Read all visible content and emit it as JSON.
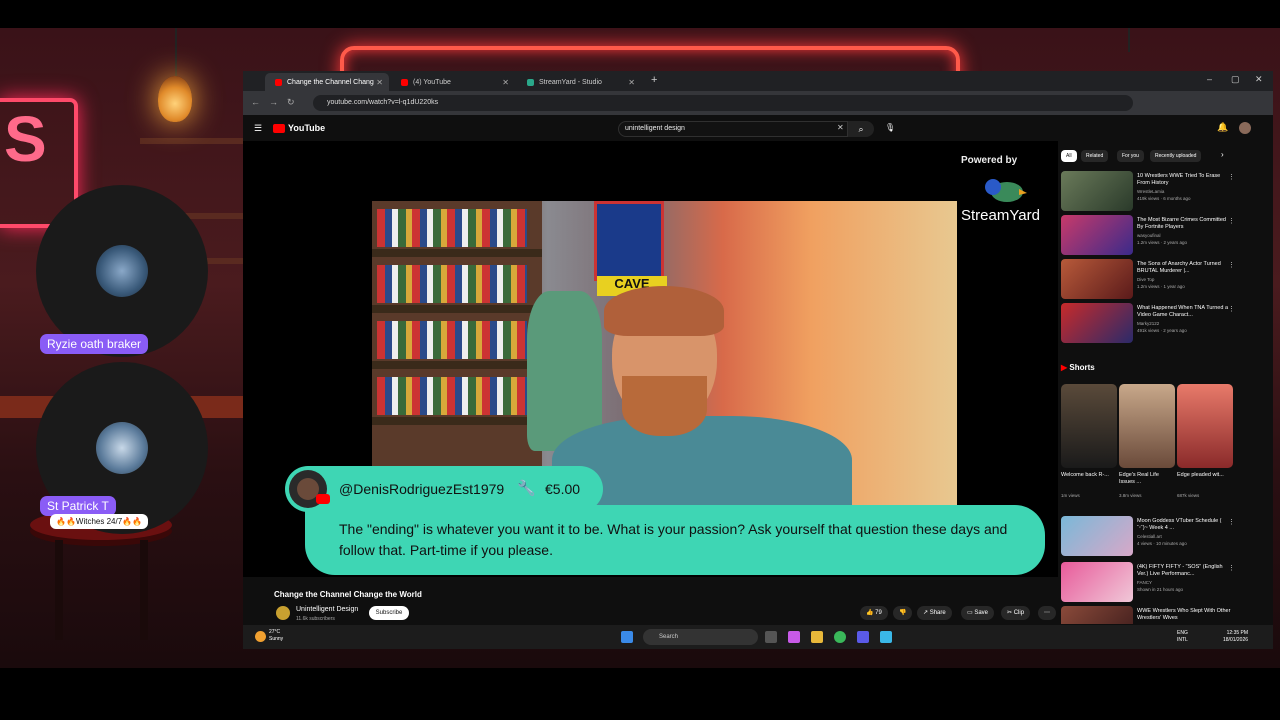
{
  "guests": [
    {
      "name": "Ryzie oath braker",
      "sub": ""
    },
    {
      "name": "St Patrick T",
      "sub": "🔥🔥Witches 24/7🔥🔥"
    }
  ],
  "browser": {
    "tabs": [
      {
        "label": "Change the Channel Chang",
        "active": true
      },
      {
        "label": "(4) YouTube",
        "active": false
      },
      {
        "label": "StreamYard - Studio",
        "active": false
      }
    ],
    "url": "youtube.com/watch?v=l-q1dU220ks"
  },
  "youtube": {
    "logo": "YouTube",
    "search_value": "unintelligent design",
    "video_title": "Change the Channel Change the World",
    "channel_name": "Unintelligent Design",
    "channel_subs": "11.6k subscribers",
    "subscribe_label": "Subscribe",
    "actions": {
      "like": "79",
      "share": "Share",
      "save": "Save",
      "clip": "Clip"
    }
  },
  "overlay": {
    "powered_by": "Powered by",
    "brand": "StreamYard",
    "cave_sign": "CAVE"
  },
  "superchat": {
    "username": "@DenisRodriguezEst1979",
    "amount": "€5.00",
    "message": "The \"ending\" is whatever you want it to be. What is your passion? Ask yourself that question these days and follow that. Part-time if you please."
  },
  "sidebar": {
    "chips": [
      "All",
      "Related",
      "For you",
      "Recently uploaded"
    ],
    "recommendations": [
      {
        "title": "10 Wrestlers WWE Tried To Erase From History",
        "channel": "WrestleLamia",
        "meta": "419k views · 6 months ago",
        "color": "#6a7a5a"
      },
      {
        "title": "The Most Bizarre Crimes Committed By Fortnite Players",
        "channel": "wasyoufinal",
        "meta": "1.2m views · 2 years ago",
        "color": "#c83a6a"
      },
      {
        "title": "The Sons of Anarchy Actor Turned BRUTAL Murderer |...",
        "channel": "Dive Top",
        "meta": "1.2m views · 1 year ago",
        "color": "#b85a3a"
      },
      {
        "title": "What Happened When TNA Turned a Video Game Charact...",
        "channel": "Marky2122",
        "meta": "491k views · 2 years ago",
        "color": "#c82a2a"
      },
      {
        "title": "Moon Goddess VTuber Schedule ( ˘ᵕ˘)~ Week 4 ...",
        "channel": "Celestiall.art",
        "meta": "4 views · 10 minutes ago",
        "color": "#7ab8d8"
      },
      {
        "title": "(4K) FIFTY FIFTY - \"SOS\" (English Ver.) Live Performanc...",
        "channel": "FANCY",
        "meta": "Shown in 21 hours ago",
        "color": "#e85a9a"
      },
      {
        "title": "WWE Wrestlers Who Slept With Other Wrestlers' Wives",
        "channel": "",
        "meta": "",
        "color": "#8a4a3a"
      }
    ],
    "shorts_title": "Shorts",
    "shorts": [
      {
        "title": "Welcome back R-...",
        "meta": "1m views",
        "color": "#3a2a2a"
      },
      {
        "title": "Edge's Real Life Issues ...",
        "meta": "3.8m views",
        "color": "#8a5a4a"
      },
      {
        "title": "Edge pleaded wit...",
        "meta": "687k views",
        "color": "#c84a3a"
      }
    ]
  },
  "taskbar": {
    "weather_temp": "27°C",
    "weather_desc": "Sunny",
    "search": "Search",
    "lang_top": "ENG",
    "lang_bottom": "INTL",
    "time": "12:35 PM",
    "date": "18/01/2026"
  }
}
